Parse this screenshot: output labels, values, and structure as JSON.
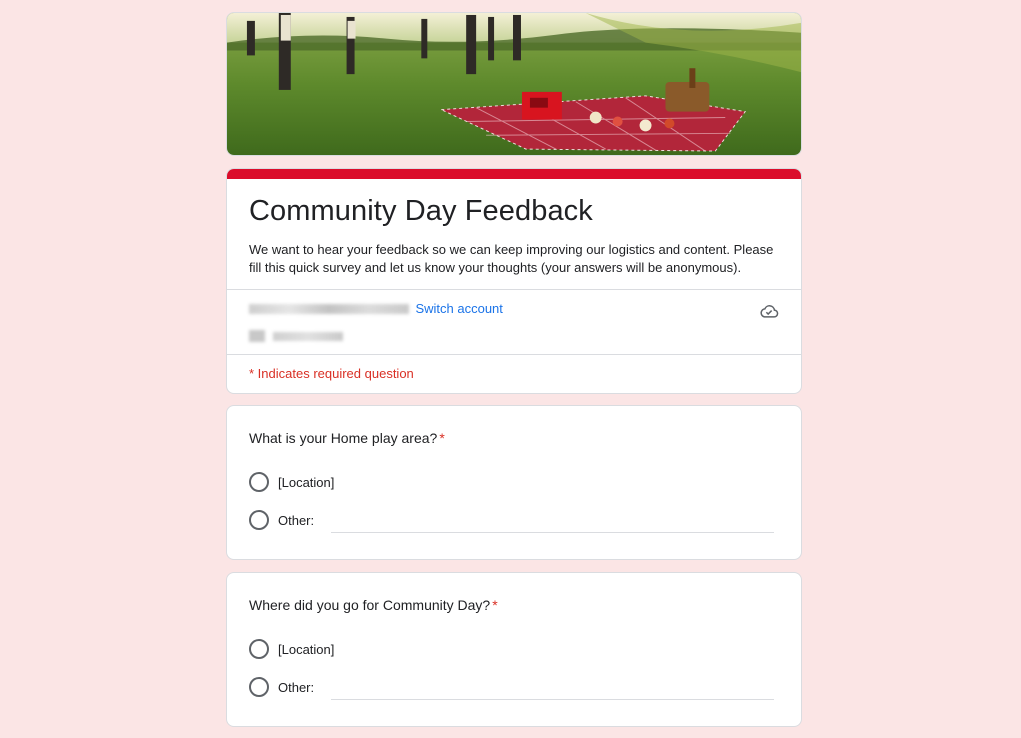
{
  "form": {
    "title": "Community Day Feedback",
    "description": "We want to hear your feedback so we can keep improving our logistics and content. Please fill this quick survey and let us know your thoughts (your answers will be anonymous).",
    "switch_account_label": "Switch account",
    "required_note": "* Indicates required question",
    "accent_color": "#db0d2b",
    "background_color": "#fbe5e5",
    "icons": {
      "save_status": "cloud-check-icon",
      "banner": "picnic-banner-image"
    }
  },
  "questions": [
    {
      "title": "What is your Home play area?",
      "required_mark": "*",
      "options": [
        {
          "label": "[Location]"
        },
        {
          "label": "Other:"
        }
      ]
    },
    {
      "title": "Where did you go for Community Day?",
      "required_mark": "*",
      "options": [
        {
          "label": "[Location]"
        },
        {
          "label": "Other:"
        }
      ]
    }
  ]
}
